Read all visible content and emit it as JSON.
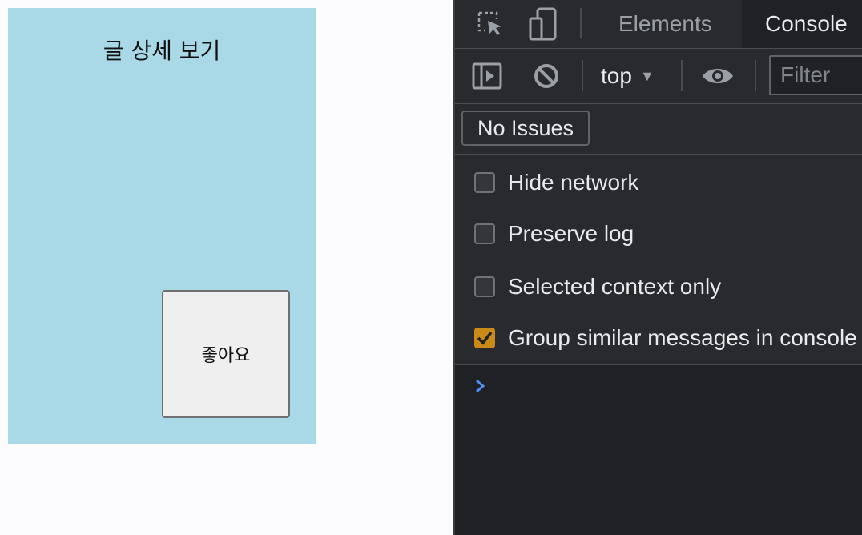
{
  "page": {
    "title": "글 상세 보기",
    "like_button": "좋아요"
  },
  "devtools": {
    "tabs": [
      {
        "label": "Elements",
        "active": false
      },
      {
        "label": "Console",
        "active": true
      }
    ],
    "toolbar": {
      "context": "top",
      "filter_placeholder": "Filter"
    },
    "issues_button": "No Issues",
    "settings": [
      {
        "label": "Hide network",
        "checked": false
      },
      {
        "label": "Preserve log",
        "checked": false
      },
      {
        "label": "Selected context only",
        "checked": false
      },
      {
        "label": "Group similar messages in console",
        "checked": true
      }
    ],
    "icons": [
      "inspect-element-icon",
      "device-toolbar-icon",
      "sidebar-toggle-icon",
      "clear-console-icon",
      "live-expression-eye-icon",
      "console-prompt-icon"
    ],
    "colors": {
      "panel_bg": "#202124",
      "toolbar_bg": "#292a2d",
      "checkbox_checked": "#c98a1a",
      "prompt": "#4c8df6",
      "card_bg": "#a9d9e7"
    }
  }
}
